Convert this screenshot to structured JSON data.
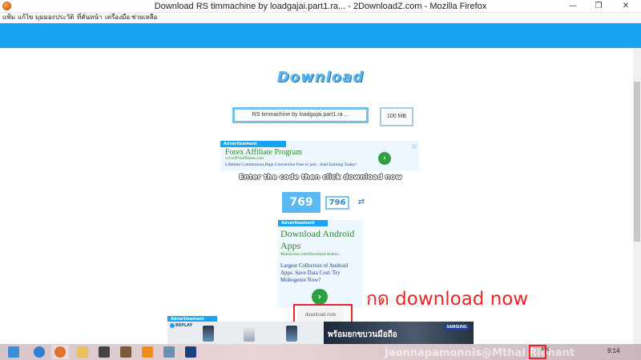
{
  "window": {
    "title": "Download RS timmachine by loadgajai.part1.ra... - 2DownloadZ.com - Mozilla Firefox",
    "min_glyph": "—",
    "max_glyph": "❐",
    "close_glyph": "✕"
  },
  "menu": [
    "แฟ้ม",
    "แก้ไข",
    "มุมมอง",
    "ประวัติ",
    "ที่คั่นหน้า",
    "เครื่องมือ",
    "ช่วยเหลือ"
  ],
  "page": {
    "heading": "Download",
    "filename": "RS timmachine by loadgajai.part1.ra ...",
    "filesize": "100 MB",
    "instruction": "Enter the code then click download now",
    "captcha_code": "769",
    "captcha_input": "796",
    "refresh_glyph": "⇄",
    "download_button": "download now",
    "annotation": "กด download now"
  },
  "ads": {
    "tag": "Advertisement",
    "ad1": {
      "headline": "Forex Affiliate Program",
      "url": "www.HYIeffStates.com",
      "desc": "Lifetime Commission,High Conversion Free to join , Start Earning Today!",
      "go": "›"
    },
    "ad2": {
      "headline": "Download Android Apps",
      "url": "MoboGenie.com/Download-Androi...",
      "desc": "Largest Collection of Android Apps. Save Data Cost. Try Mobogenie Now?",
      "go": "›"
    },
    "ad3": {
      "tag": "Advertisement",
      "replay": "REPLAY",
      "thai_text": "พร้อมยกขบวนมือถือ",
      "brand": "SAMSUNG"
    }
  },
  "taskbar": {
    "lang": "EN",
    "clock": "9:14",
    "watermark": "Jaonnapamonnis@Mthai Riohant"
  },
  "colors": {
    "accent_blue": "#1aa3f2",
    "annotation_red": "#e8262a",
    "ad_green": "#2a8b2a"
  }
}
